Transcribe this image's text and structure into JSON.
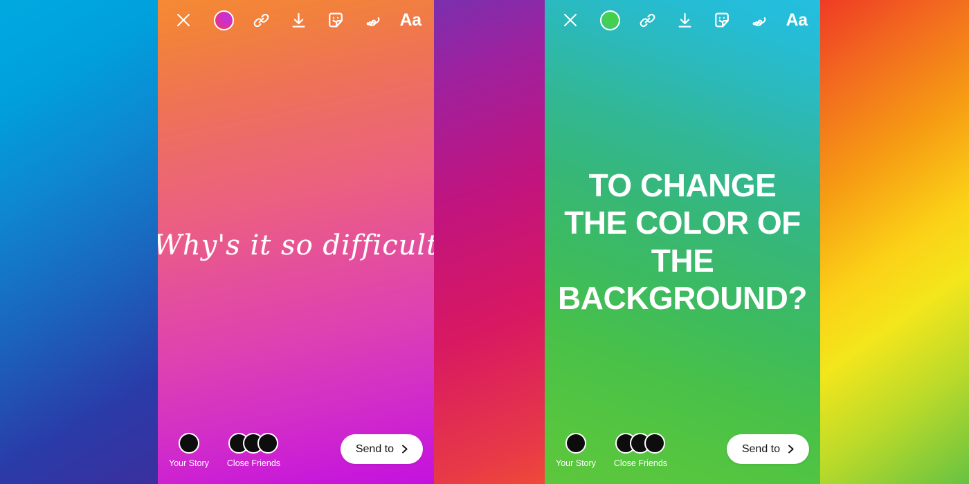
{
  "backdrop": {
    "left_band_colors": [
      "#00a9e0",
      "#1b63bd",
      "#3b2f9e"
    ],
    "mid_band_colors": [
      "#7b2fae",
      "#c0147f",
      "#ef4a38"
    ],
    "right_band_colors": [
      "#ef3b24",
      "#fbd217",
      "#67c242"
    ]
  },
  "panels": [
    {
      "name": "instagram-story-editor-pink",
      "background_colors": [
        "#f58a34",
        "#eb5f82",
        "#c412de"
      ],
      "toolbar": {
        "close_label": "Close",
        "close_icon": "close-icon",
        "items": [
          {
            "icon": "color-circle-icon",
            "label": "Background color",
            "color": "#e5357f"
          },
          {
            "icon": "link-icon",
            "label": "Link"
          },
          {
            "icon": "download-icon",
            "label": "Save"
          },
          {
            "icon": "sticker-icon",
            "label": "Stickers"
          },
          {
            "icon": "draw-icon",
            "label": "Draw"
          },
          {
            "icon": "text-icon",
            "label": "Aa"
          }
        ]
      },
      "story_text": "Why's it so difficult",
      "story_text_style": "script",
      "bottom": {
        "audience": [
          {
            "label": "Your Story",
            "avatar": "single"
          },
          {
            "label": "Close Friends",
            "avatar": "stack"
          }
        ],
        "send_label": "Send to",
        "send_icon": "chevron-right-icon"
      }
    },
    {
      "name": "instagram-story-editor-green",
      "background_colors": [
        "#24bfe0",
        "#37b775",
        "#5dc73c"
      ],
      "toolbar": {
        "close_label": "Close",
        "close_icon": "close-icon",
        "items": [
          {
            "icon": "color-circle-icon",
            "label": "Background color",
            "color": "#45cf56"
          },
          {
            "icon": "link-icon",
            "label": "Link"
          },
          {
            "icon": "download-icon",
            "label": "Save"
          },
          {
            "icon": "sticker-icon",
            "label": "Stickers"
          },
          {
            "icon": "draw-icon",
            "label": "Draw"
          },
          {
            "icon": "text-icon",
            "label": "Aa"
          }
        ]
      },
      "story_text": "TO CHANGE THE COLOR OF THE BACKGROUND?",
      "story_text_style": "block",
      "bottom": {
        "audience": [
          {
            "label": "Your Story",
            "avatar": "single"
          },
          {
            "label": "Close Friends",
            "avatar": "stack"
          }
        ],
        "send_label": "Send to",
        "send_icon": "chevron-right-icon"
      }
    }
  ]
}
